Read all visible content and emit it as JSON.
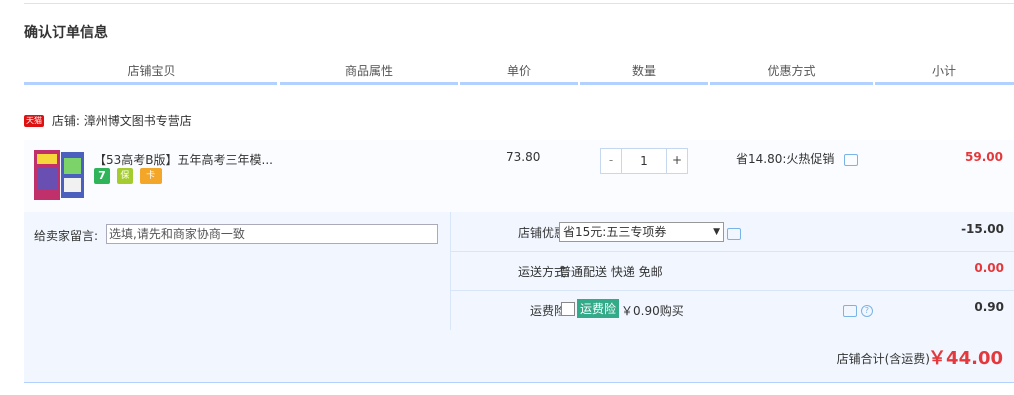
{
  "page_title": "确认订单信息",
  "columns": [
    "店铺宝贝",
    "商品属性",
    "单价",
    "数量",
    "优惠方式",
    "小计"
  ],
  "shop": {
    "badge": "天猫",
    "label": "店铺:",
    "name": "漳州博文图书专营店"
  },
  "item": {
    "title": "【53高考B版】五年高考三年模...",
    "unit_price": "73.80",
    "qty_minus": "-",
    "qty": "1",
    "qty_plus": "+",
    "promo": "省14.80:火热促销",
    "subtotal": "59.00",
    "badges": [
      "7",
      "保",
      "卡"
    ]
  },
  "message": {
    "label": "给卖家留言:",
    "value": "选填,请先和商家协商一致"
  },
  "shop_discount": {
    "label": "店铺优惠:",
    "selected": "省15元:五三专项券",
    "amount": "-15.00"
  },
  "shipping": {
    "label": "运送方式:",
    "value": "普通配送 快递 免邮",
    "amount": "0.00"
  },
  "insurance": {
    "label": "运费险:",
    "tag": "运费险",
    "text": "￥0.90购买",
    "amount": "0.90",
    "help": "?"
  },
  "total": {
    "label": "店铺合计(含运费)",
    "value": "￥44.00"
  },
  "colors": {
    "accent_red": "#e4393c",
    "header_bar": "#b2d1ff",
    "options_bg": "#f2f7ff",
    "insurance_tag": "#33aa88"
  }
}
